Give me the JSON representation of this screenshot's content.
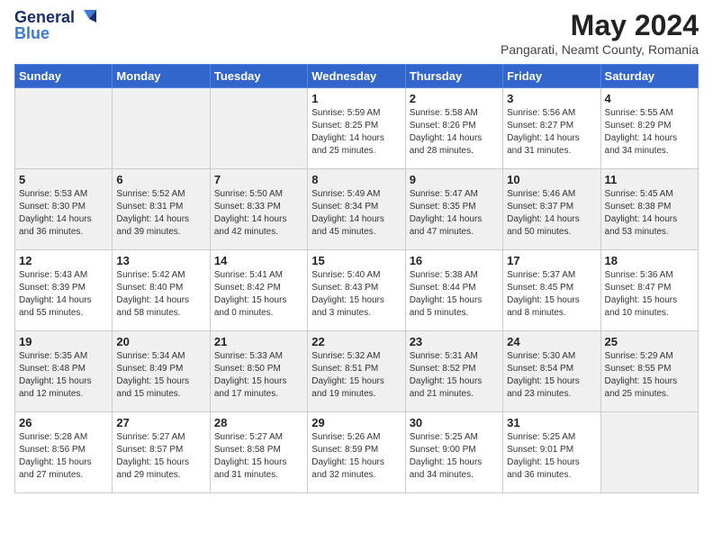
{
  "logo": {
    "line1": "General",
    "line2": "Blue"
  },
  "title": "May 2024",
  "subtitle": "Pangarati, Neamt County, Romania",
  "headers": [
    "Sunday",
    "Monday",
    "Tuesday",
    "Wednesday",
    "Thursday",
    "Friday",
    "Saturday"
  ],
  "rows": [
    [
      {
        "date": "",
        "info": "",
        "empty": true
      },
      {
        "date": "",
        "info": "",
        "empty": true
      },
      {
        "date": "",
        "info": "",
        "empty": true
      },
      {
        "date": "1",
        "info": "Sunrise: 5:59 AM\nSunset: 8:25 PM\nDaylight: 14 hours\nand 25 minutes.",
        "empty": false
      },
      {
        "date": "2",
        "info": "Sunrise: 5:58 AM\nSunset: 8:26 PM\nDaylight: 14 hours\nand 28 minutes.",
        "empty": false
      },
      {
        "date": "3",
        "info": "Sunrise: 5:56 AM\nSunset: 8:27 PM\nDaylight: 14 hours\nand 31 minutes.",
        "empty": false
      },
      {
        "date": "4",
        "info": "Sunrise: 5:55 AM\nSunset: 8:29 PM\nDaylight: 14 hours\nand 34 minutes.",
        "empty": false
      }
    ],
    [
      {
        "date": "5",
        "info": "Sunrise: 5:53 AM\nSunset: 8:30 PM\nDaylight: 14 hours\nand 36 minutes.",
        "empty": false
      },
      {
        "date": "6",
        "info": "Sunrise: 5:52 AM\nSunset: 8:31 PM\nDaylight: 14 hours\nand 39 minutes.",
        "empty": false
      },
      {
        "date": "7",
        "info": "Sunrise: 5:50 AM\nSunset: 8:33 PM\nDaylight: 14 hours\nand 42 minutes.",
        "empty": false
      },
      {
        "date": "8",
        "info": "Sunrise: 5:49 AM\nSunset: 8:34 PM\nDaylight: 14 hours\nand 45 minutes.",
        "empty": false
      },
      {
        "date": "9",
        "info": "Sunrise: 5:47 AM\nSunset: 8:35 PM\nDaylight: 14 hours\nand 47 minutes.",
        "empty": false
      },
      {
        "date": "10",
        "info": "Sunrise: 5:46 AM\nSunset: 8:37 PM\nDaylight: 14 hours\nand 50 minutes.",
        "empty": false
      },
      {
        "date": "11",
        "info": "Sunrise: 5:45 AM\nSunset: 8:38 PM\nDaylight: 14 hours\nand 53 minutes.",
        "empty": false
      }
    ],
    [
      {
        "date": "12",
        "info": "Sunrise: 5:43 AM\nSunset: 8:39 PM\nDaylight: 14 hours\nand 55 minutes.",
        "empty": false
      },
      {
        "date": "13",
        "info": "Sunrise: 5:42 AM\nSunset: 8:40 PM\nDaylight: 14 hours\nand 58 minutes.",
        "empty": false
      },
      {
        "date": "14",
        "info": "Sunrise: 5:41 AM\nSunset: 8:42 PM\nDaylight: 15 hours\nand 0 minutes.",
        "empty": false
      },
      {
        "date": "15",
        "info": "Sunrise: 5:40 AM\nSunset: 8:43 PM\nDaylight: 15 hours\nand 3 minutes.",
        "empty": false
      },
      {
        "date": "16",
        "info": "Sunrise: 5:38 AM\nSunset: 8:44 PM\nDaylight: 15 hours\nand 5 minutes.",
        "empty": false
      },
      {
        "date": "17",
        "info": "Sunrise: 5:37 AM\nSunset: 8:45 PM\nDaylight: 15 hours\nand 8 minutes.",
        "empty": false
      },
      {
        "date": "18",
        "info": "Sunrise: 5:36 AM\nSunset: 8:47 PM\nDaylight: 15 hours\nand 10 minutes.",
        "empty": false
      }
    ],
    [
      {
        "date": "19",
        "info": "Sunrise: 5:35 AM\nSunset: 8:48 PM\nDaylight: 15 hours\nand 12 minutes.",
        "empty": false
      },
      {
        "date": "20",
        "info": "Sunrise: 5:34 AM\nSunset: 8:49 PM\nDaylight: 15 hours\nand 15 minutes.",
        "empty": false
      },
      {
        "date": "21",
        "info": "Sunrise: 5:33 AM\nSunset: 8:50 PM\nDaylight: 15 hours\nand 17 minutes.",
        "empty": false
      },
      {
        "date": "22",
        "info": "Sunrise: 5:32 AM\nSunset: 8:51 PM\nDaylight: 15 hours\nand 19 minutes.",
        "empty": false
      },
      {
        "date": "23",
        "info": "Sunrise: 5:31 AM\nSunset: 8:52 PM\nDaylight: 15 hours\nand 21 minutes.",
        "empty": false
      },
      {
        "date": "24",
        "info": "Sunrise: 5:30 AM\nSunset: 8:54 PM\nDaylight: 15 hours\nand 23 minutes.",
        "empty": false
      },
      {
        "date": "25",
        "info": "Sunrise: 5:29 AM\nSunset: 8:55 PM\nDaylight: 15 hours\nand 25 minutes.",
        "empty": false
      }
    ],
    [
      {
        "date": "26",
        "info": "Sunrise: 5:28 AM\nSunset: 8:56 PM\nDaylight: 15 hours\nand 27 minutes.",
        "empty": false
      },
      {
        "date": "27",
        "info": "Sunrise: 5:27 AM\nSunset: 8:57 PM\nDaylight: 15 hours\nand 29 minutes.",
        "empty": false
      },
      {
        "date": "28",
        "info": "Sunrise: 5:27 AM\nSunset: 8:58 PM\nDaylight: 15 hours\nand 31 minutes.",
        "empty": false
      },
      {
        "date": "29",
        "info": "Sunrise: 5:26 AM\nSunset: 8:59 PM\nDaylight: 15 hours\nand 32 minutes.",
        "empty": false
      },
      {
        "date": "30",
        "info": "Sunrise: 5:25 AM\nSunset: 9:00 PM\nDaylight: 15 hours\nand 34 minutes.",
        "empty": false
      },
      {
        "date": "31",
        "info": "Sunrise: 5:25 AM\nSunset: 9:01 PM\nDaylight: 15 hours\nand 36 minutes.",
        "empty": false
      },
      {
        "date": "",
        "info": "",
        "empty": true
      }
    ]
  ]
}
